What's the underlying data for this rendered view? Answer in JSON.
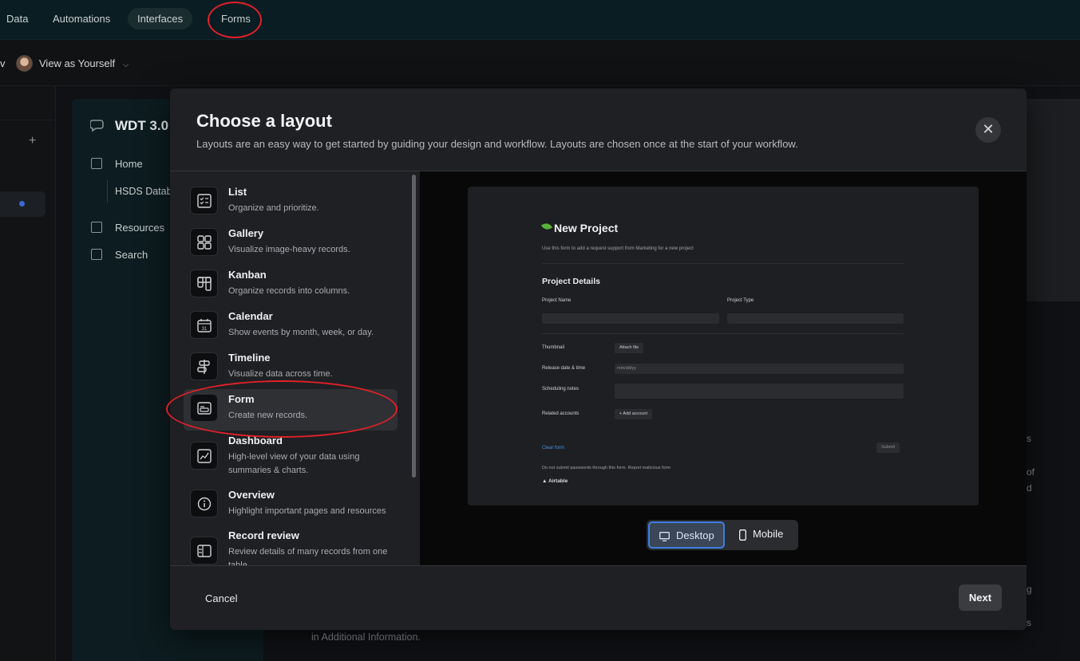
{
  "topnav": {
    "items": [
      {
        "label": "Data"
      },
      {
        "label": "Automations"
      },
      {
        "label": "Interfaces"
      },
      {
        "label": "Forms"
      }
    ]
  },
  "subbar": {
    "view_as_label": "View as Yourself",
    "left_fragment": "v"
  },
  "sidebar": {
    "title": "WDT 3.0",
    "items": [
      {
        "label": "Home"
      },
      {
        "label": "HSDS Databa"
      },
      {
        "label": "Resources"
      },
      {
        "label": "Search"
      }
    ]
  },
  "background": {
    "fragments": [
      "s",
      "of",
      "d",
      "g",
      "s"
    ],
    "bottom_text": "in Additional Information."
  },
  "modal": {
    "title": "Choose a layout",
    "subtitle": "Layouts are an easy way to get started by guiding your design and workflow. Layouts are chosen once at the start of your workflow.",
    "close_icon": "close-icon",
    "layouts": [
      {
        "name": "List",
        "desc": "Organize and prioritize.",
        "icon": "list-icon"
      },
      {
        "name": "Gallery",
        "desc": "Visualize image-heavy records.",
        "icon": "gallery-icon"
      },
      {
        "name": "Kanban",
        "desc": "Organize records into columns.",
        "icon": "kanban-icon"
      },
      {
        "name": "Calendar",
        "desc": "Show events by month, week, or day.",
        "icon": "calendar-icon"
      },
      {
        "name": "Timeline",
        "desc": "Visualize data across time.",
        "icon": "timeline-icon"
      },
      {
        "name": "Form",
        "desc": "Create new records.",
        "icon": "form-icon",
        "selected": true
      },
      {
        "name": "Dashboard",
        "desc": "High-level view of your data using summaries & charts.",
        "icon": "dashboard-icon"
      },
      {
        "name": "Overview",
        "desc": "Highlight important pages and resources",
        "icon": "info-icon"
      },
      {
        "name": "Record review",
        "desc": "Review details of many records from one table",
        "icon": "record-review-icon"
      }
    ],
    "preview": {
      "title": "New Project",
      "subtitle": "Use this form to add a request support from Marketing for a new project",
      "section": "Project Details",
      "project_name_label": "Project Name",
      "project_type_label": "Project Type",
      "thumbnail_label": "Thumbnail",
      "attach_file": "Attach file",
      "release_label": "Release date & time",
      "date_placeholder": "mm/dd/yy",
      "scheduling_label": "Scheduling notes",
      "related_label": "Related accounts",
      "add_account": "+ Add account",
      "clear_form": "Clear form",
      "submit": "Submit",
      "footer": "Do not submit passwords through this form. Report malicious form",
      "brand": "Airtable"
    },
    "view_toggle": {
      "desktop": "Desktop",
      "mobile": "Mobile",
      "active": "desktop"
    },
    "cancel_label": "Cancel",
    "next_label": "Next"
  }
}
